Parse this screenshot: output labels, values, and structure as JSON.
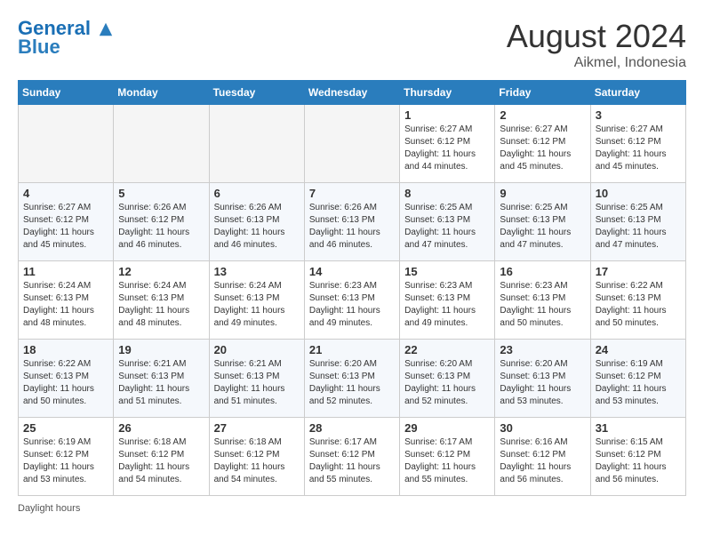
{
  "header": {
    "logo_line1": "General",
    "logo_line2": "Blue",
    "month_year": "August 2024",
    "location": "Aikmel, Indonesia"
  },
  "days_of_week": [
    "Sunday",
    "Monday",
    "Tuesday",
    "Wednesday",
    "Thursday",
    "Friday",
    "Saturday"
  ],
  "weeks": [
    [
      {
        "num": "",
        "info": ""
      },
      {
        "num": "",
        "info": ""
      },
      {
        "num": "",
        "info": ""
      },
      {
        "num": "",
        "info": ""
      },
      {
        "num": "1",
        "info": "Sunrise: 6:27 AM\nSunset: 6:12 PM\nDaylight: 11 hours\nand 44 minutes."
      },
      {
        "num": "2",
        "info": "Sunrise: 6:27 AM\nSunset: 6:12 PM\nDaylight: 11 hours\nand 45 minutes."
      },
      {
        "num": "3",
        "info": "Sunrise: 6:27 AM\nSunset: 6:12 PM\nDaylight: 11 hours\nand 45 minutes."
      }
    ],
    [
      {
        "num": "4",
        "info": "Sunrise: 6:27 AM\nSunset: 6:12 PM\nDaylight: 11 hours\nand 45 minutes."
      },
      {
        "num": "5",
        "info": "Sunrise: 6:26 AM\nSunset: 6:12 PM\nDaylight: 11 hours\nand 46 minutes."
      },
      {
        "num": "6",
        "info": "Sunrise: 6:26 AM\nSunset: 6:13 PM\nDaylight: 11 hours\nand 46 minutes."
      },
      {
        "num": "7",
        "info": "Sunrise: 6:26 AM\nSunset: 6:13 PM\nDaylight: 11 hours\nand 46 minutes."
      },
      {
        "num": "8",
        "info": "Sunrise: 6:25 AM\nSunset: 6:13 PM\nDaylight: 11 hours\nand 47 minutes."
      },
      {
        "num": "9",
        "info": "Sunrise: 6:25 AM\nSunset: 6:13 PM\nDaylight: 11 hours\nand 47 minutes."
      },
      {
        "num": "10",
        "info": "Sunrise: 6:25 AM\nSunset: 6:13 PM\nDaylight: 11 hours\nand 47 minutes."
      }
    ],
    [
      {
        "num": "11",
        "info": "Sunrise: 6:24 AM\nSunset: 6:13 PM\nDaylight: 11 hours\nand 48 minutes."
      },
      {
        "num": "12",
        "info": "Sunrise: 6:24 AM\nSunset: 6:13 PM\nDaylight: 11 hours\nand 48 minutes."
      },
      {
        "num": "13",
        "info": "Sunrise: 6:24 AM\nSunset: 6:13 PM\nDaylight: 11 hours\nand 49 minutes."
      },
      {
        "num": "14",
        "info": "Sunrise: 6:23 AM\nSunset: 6:13 PM\nDaylight: 11 hours\nand 49 minutes."
      },
      {
        "num": "15",
        "info": "Sunrise: 6:23 AM\nSunset: 6:13 PM\nDaylight: 11 hours\nand 49 minutes."
      },
      {
        "num": "16",
        "info": "Sunrise: 6:23 AM\nSunset: 6:13 PM\nDaylight: 11 hours\nand 50 minutes."
      },
      {
        "num": "17",
        "info": "Sunrise: 6:22 AM\nSunset: 6:13 PM\nDaylight: 11 hours\nand 50 minutes."
      }
    ],
    [
      {
        "num": "18",
        "info": "Sunrise: 6:22 AM\nSunset: 6:13 PM\nDaylight: 11 hours\nand 50 minutes."
      },
      {
        "num": "19",
        "info": "Sunrise: 6:21 AM\nSunset: 6:13 PM\nDaylight: 11 hours\nand 51 minutes."
      },
      {
        "num": "20",
        "info": "Sunrise: 6:21 AM\nSunset: 6:13 PM\nDaylight: 11 hours\nand 51 minutes."
      },
      {
        "num": "21",
        "info": "Sunrise: 6:20 AM\nSunset: 6:13 PM\nDaylight: 11 hours\nand 52 minutes."
      },
      {
        "num": "22",
        "info": "Sunrise: 6:20 AM\nSunset: 6:13 PM\nDaylight: 11 hours\nand 52 minutes."
      },
      {
        "num": "23",
        "info": "Sunrise: 6:20 AM\nSunset: 6:13 PM\nDaylight: 11 hours\nand 53 minutes."
      },
      {
        "num": "24",
        "info": "Sunrise: 6:19 AM\nSunset: 6:12 PM\nDaylight: 11 hours\nand 53 minutes."
      }
    ],
    [
      {
        "num": "25",
        "info": "Sunrise: 6:19 AM\nSunset: 6:12 PM\nDaylight: 11 hours\nand 53 minutes."
      },
      {
        "num": "26",
        "info": "Sunrise: 6:18 AM\nSunset: 6:12 PM\nDaylight: 11 hours\nand 54 minutes."
      },
      {
        "num": "27",
        "info": "Sunrise: 6:18 AM\nSunset: 6:12 PM\nDaylight: 11 hours\nand 54 minutes."
      },
      {
        "num": "28",
        "info": "Sunrise: 6:17 AM\nSunset: 6:12 PM\nDaylight: 11 hours\nand 55 minutes."
      },
      {
        "num": "29",
        "info": "Sunrise: 6:17 AM\nSunset: 6:12 PM\nDaylight: 11 hours\nand 55 minutes."
      },
      {
        "num": "30",
        "info": "Sunrise: 6:16 AM\nSunset: 6:12 PM\nDaylight: 11 hours\nand 56 minutes."
      },
      {
        "num": "31",
        "info": "Sunrise: 6:15 AM\nSunset: 6:12 PM\nDaylight: 11 hours\nand 56 minutes."
      }
    ]
  ],
  "footer": {
    "daylight_label": "Daylight hours"
  }
}
